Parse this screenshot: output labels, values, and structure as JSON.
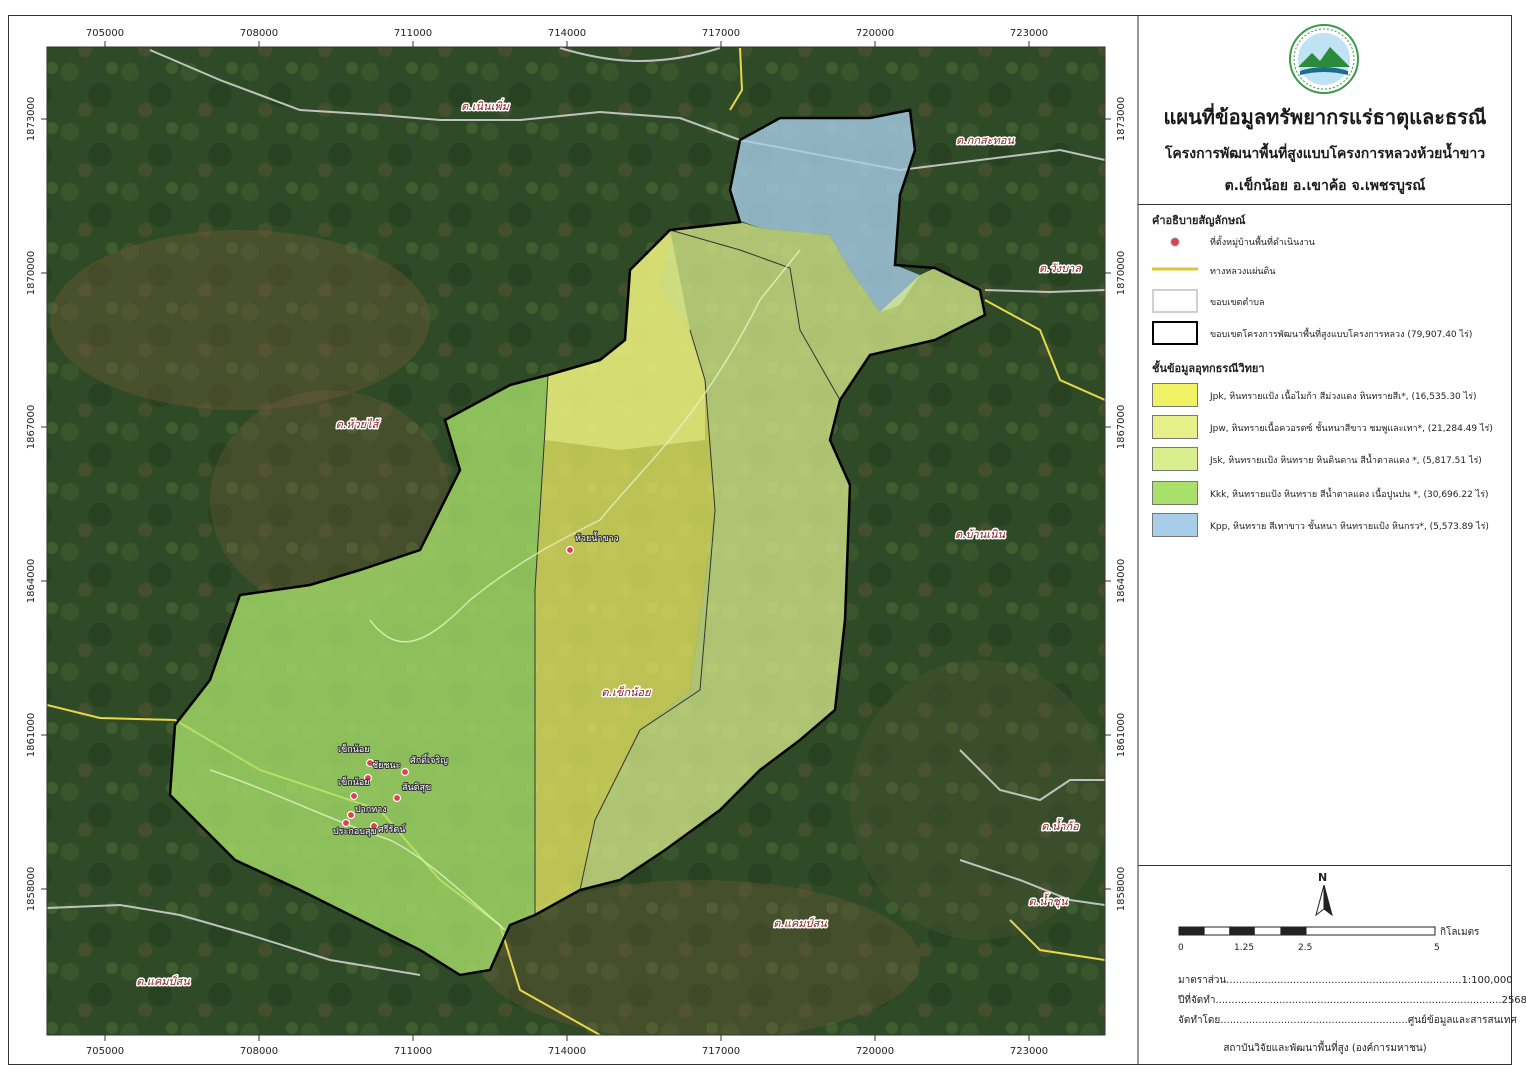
{
  "map": {
    "x_ticks": [
      "705000",
      "708000",
      "711000",
      "714000",
      "717000",
      "720000",
      "723000"
    ],
    "y_ticks": [
      "1873000",
      "1870000",
      "1867000",
      "1864000",
      "1861000",
      "1858000"
    ],
    "place_labels": {
      "noen_phoem": "ต.เนินเพิ่ม",
      "kok_sathon": "ต.กกสะทอน",
      "wang_ban": "ต.วังบาล",
      "huai_sai": "ต.ห้วยไส้",
      "ban_noen": "ต.บ้านเนิน",
      "khek_noi": "ต.เข็กน้อย",
      "nam_ko": "ต.น้ำก้อ",
      "nam_chun": "ต.น้ำชุน",
      "khaem_son_1": "ต.แคมป์สน",
      "khaem_son_2": "ต.แคมป์สน"
    },
    "villages": {
      "huai_nam_khao": "ห้วยน้ำขาว",
      "khek_noi_1": "เข็กน้อย",
      "chai_chana": "ชัยชนะ",
      "sak_charoen": "ศักดิ์เจริญ",
      "khek_noi_2": "เข็กน้อย",
      "san_ti_suk": "สันติสุข",
      "pak_thang": "ปากทาง",
      "prakop_suk": "ประกอบสุข",
      "si_rat": "ศรีรัตน์"
    },
    "colors": {
      "satellite": "#2f4a26",
      "jpk": "#f2f266",
      "jpw": "#e8f08a",
      "jsk": "#d9ee8c",
      "kkk": "#a8e06a",
      "kpp": "#a8cde8",
      "road": "#e8d84a",
      "subdistrict_boundary": "#d8d8d8",
      "project_boundary": "#000000",
      "village_marker": "#e04050"
    }
  },
  "legend": {
    "title_main": "แผนที่ข้อมูลทรัพยากรแร่ธาตุและธรณี",
    "title_sub": "โครงการพัฒนาพื้นที่สูงแบบโครงการหลวงห้วยน้ำขาว",
    "title_location": "ต.เข็กน้อย อ.เขาค้อ จ.เพชรบูรณ์",
    "symbols_heading": "คำอธิบายสัญลักษณ์",
    "village": "ที่ตั้งหมู่บ้านพื้นที่ดำเนินงาน",
    "road": "ทางหลวงแผ่นดิน",
    "subdistrict": "ขอบเขตตำบล",
    "project_area": "ขอบเขตโครงการพัฒนาพื้นที่สูงแบบโครงการหลวง (79,907.40 ไร่)",
    "geology_heading": "ชั้นข้อมูลอุทกธรณีวิทยา",
    "units": [
      {
        "label": "Jpk, หินทรายแป้ง เนื้อไมก้า สีม่วงแดง หินทรายสีเ*, (16,535.30 ไร่)",
        "color": "#f2f266"
      },
      {
        "label": "Jpw, หินทรายเนื้อควอรตซ์ ชั้นหนาสีขาว ชมพูและเทา*, (21,284.49 ไร่)",
        "color": "#e8f08a"
      },
      {
        "label": "Jsk, หินทรายแป้ง หินทราย หินดินดาน สีน้ำตาลแดง *, (5,817.51 ไร่)",
        "color": "#d9ee8c"
      },
      {
        "label": "Kkk, หินทรายแป้ง หินทราย สีน้ำตาลแดง เนื้อปูนปน *, (30,696.22 ไร่)",
        "color": "#a8e06a"
      },
      {
        "label": "Kpp, หินทราย สีเทาขาว ชั้นหนา หินทรายแป้ง หินกรว*, (5,573.89 ไร่)",
        "color": "#a8cde8"
      }
    ],
    "north": "N",
    "scale_ticks": [
      "0",
      "1.25",
      "2.5",
      "5"
    ],
    "scale_unit": "กิโลเมตร",
    "scale_text": "มาตราส่วน..........................................................................1:100,000",
    "year_text": "ปีที่จัดทำ..........................................................................................2568",
    "by_text": "จัดทำโดย...........................................................ศูนย์ข้อมูลและสารสนเทศ",
    "credit": "สถาบันวิจัยและพัฒนาพื้นที่สูง (องค์การมหาชน)"
  }
}
